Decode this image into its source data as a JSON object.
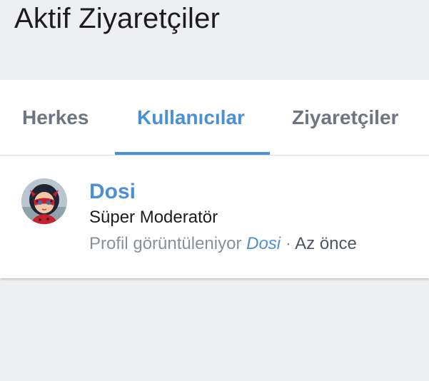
{
  "header": {
    "title": "Aktif Ziyaretçiler"
  },
  "tabs": [
    {
      "label": "Herkes",
      "active": false
    },
    {
      "label": "Kullanıcılar",
      "active": true
    },
    {
      "label": "Ziyaretçiler",
      "active": false
    }
  ],
  "visitors": [
    {
      "name": "Dosi",
      "role": "Süper Moderatör",
      "activity_prefix": "Profil görüntüleniyor",
      "activity_target": "Dosi",
      "separator": "·",
      "time": "Az önce"
    }
  ],
  "colors": {
    "accent": "#4a90d9",
    "background": "#eeeff1",
    "card": "#ffffff",
    "tab_inactive": "#6d7680",
    "muted_text": "#8a9097"
  }
}
